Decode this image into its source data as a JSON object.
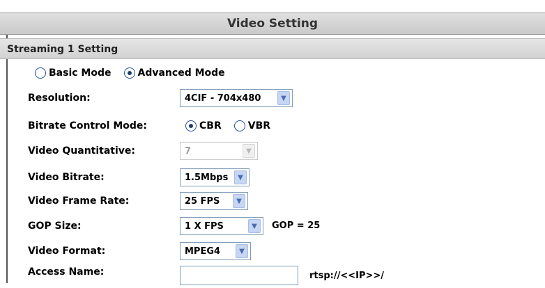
{
  "header": {
    "title": "Video Setting"
  },
  "section": {
    "title": "Streaming 1 Setting"
  },
  "mode": {
    "basic_label": "Basic Mode",
    "advanced_label": "Advanced Mode",
    "selected": "advanced"
  },
  "resolution": {
    "label": "Resolution:",
    "value": "4CIF - 704x480"
  },
  "bitrate_mode": {
    "label": "Bitrate Control Mode:",
    "cbr_label": "CBR",
    "vbr_label": "VBR",
    "selected": "CBR"
  },
  "quantitative": {
    "label": "Video Quantitative:",
    "value": "7"
  },
  "bitrate": {
    "label": "Video Bitrate:",
    "value": "1.5Mbps"
  },
  "frame_rate": {
    "label": "Video Frame Rate:",
    "value": "25 FPS"
  },
  "gop": {
    "label": "GOP Size:",
    "value": "1 X FPS",
    "note": "GOP = 25"
  },
  "format": {
    "label": "Video Format:",
    "value": "MPEG4"
  },
  "access": {
    "label": "Access Name:",
    "value": "",
    "note": "rtsp://<<IP>>/"
  },
  "icons": {
    "dropdown": "chevron-down-icon",
    "radio": "radio-icon"
  }
}
